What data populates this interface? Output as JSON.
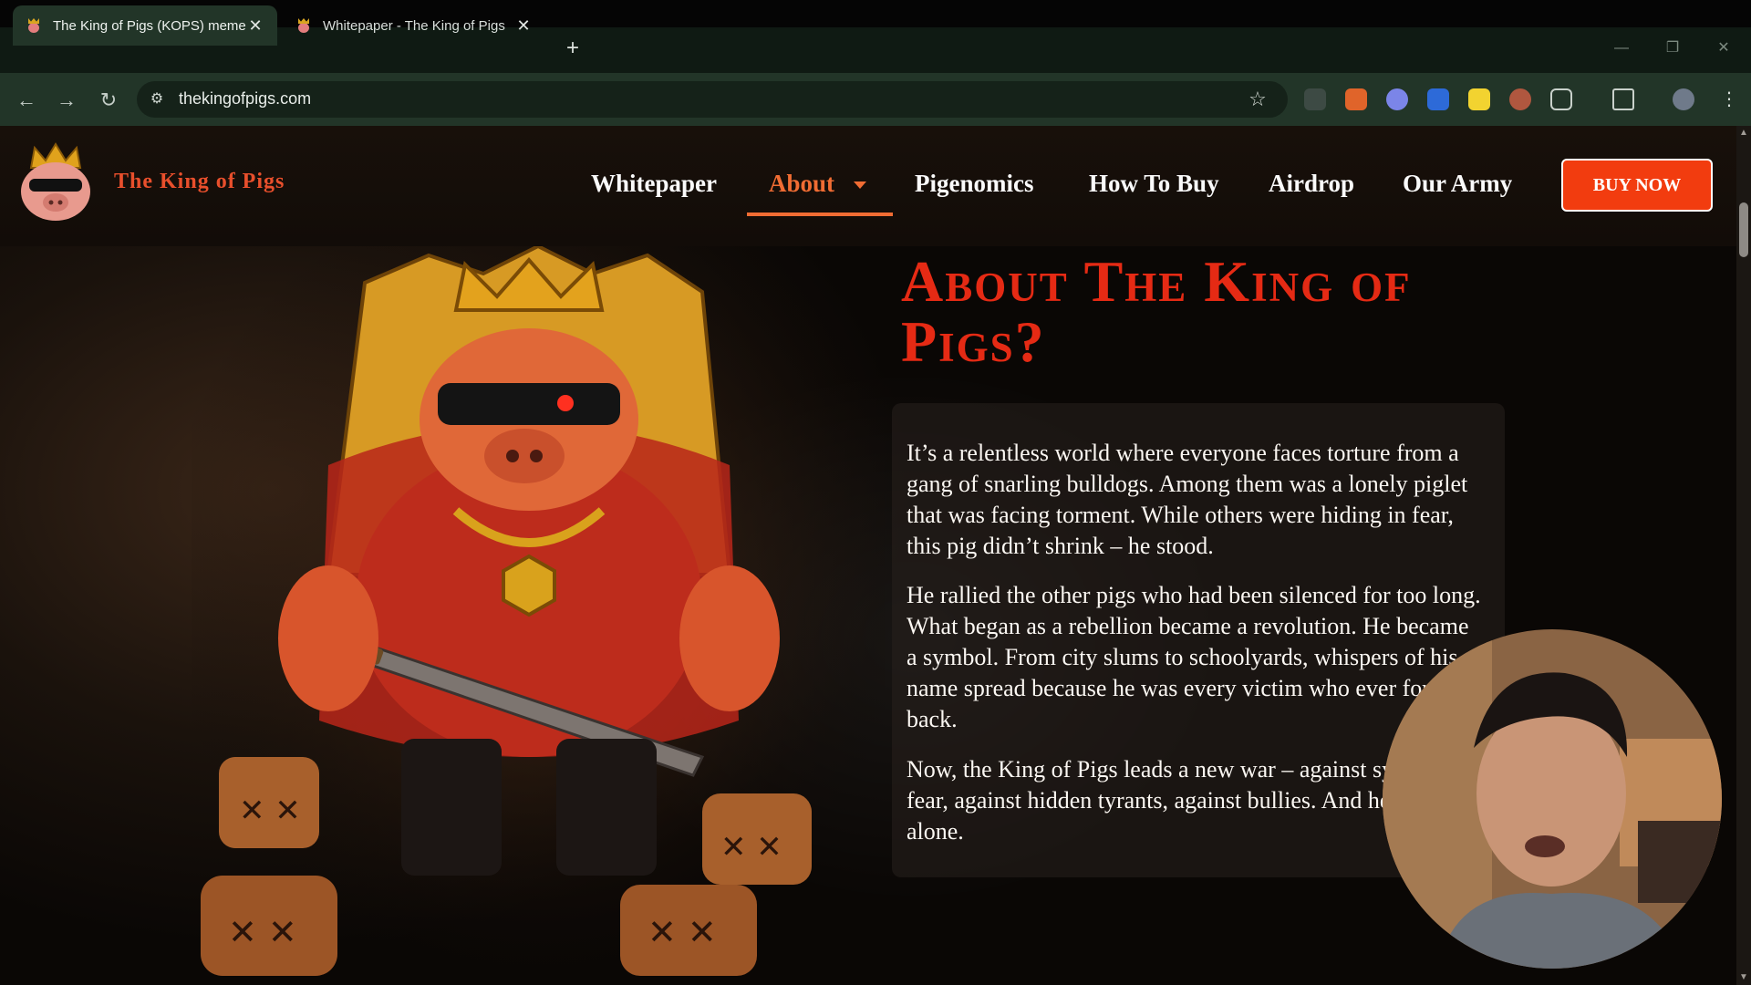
{
  "browser": {
    "tabs": [
      {
        "title": "The King of Pigs (KOPS) meme",
        "active": true
      },
      {
        "title": "Whitepaper - The King of Pigs",
        "active": false
      }
    ],
    "new_tab_icon": "plus-icon",
    "url": "thekingofpigs.com",
    "window_controls": [
      "minimize-icon",
      "restore-icon",
      "close-icon"
    ],
    "extensions": [
      "shield-extension-icon",
      "fox-extension-icon",
      "ghost-extension-icon",
      "cursor-extension-icon",
      "s-extension-icon",
      "mask-extension-icon",
      "puzzle-icon",
      "cast-icon",
      "profile-avatar",
      "more-menu-icon"
    ]
  },
  "site": {
    "brand": "The King of Pigs",
    "nav": {
      "whitepaper": "Whitepaper",
      "about": "About",
      "pigenomics": "Pigenomics",
      "how_to_buy": "How To Buy",
      "airdrop": "Airdrop",
      "our_army": "Our Army"
    },
    "buy_button": "BUY NOW",
    "about": {
      "title": "About The King of Pigs?",
      "paragraphs": [
        "It’s a relentless world where everyone faces torture from a gang of snarling bulldogs. Among them was a lonely piglet that was facing torment. While others were hiding in fear, this pig didn’t shrink – he stood.",
        "He rallied the other pigs who had been silenced for too long. What began as a rebellion became a revolution. He became a symbol. From city slums to schoolyards, whispers of his name spread because he was every victim who ever fought back.",
        "Now, the King of Pigs leads a new war – against systemic fear, against hidden tyrants, against bullies. And he’s not alone."
      ]
    }
  },
  "colors": {
    "accent": "#f06c33",
    "title_red": "#e52a14",
    "buy_button": "#f23c0f",
    "tab_bg": "#223528"
  }
}
